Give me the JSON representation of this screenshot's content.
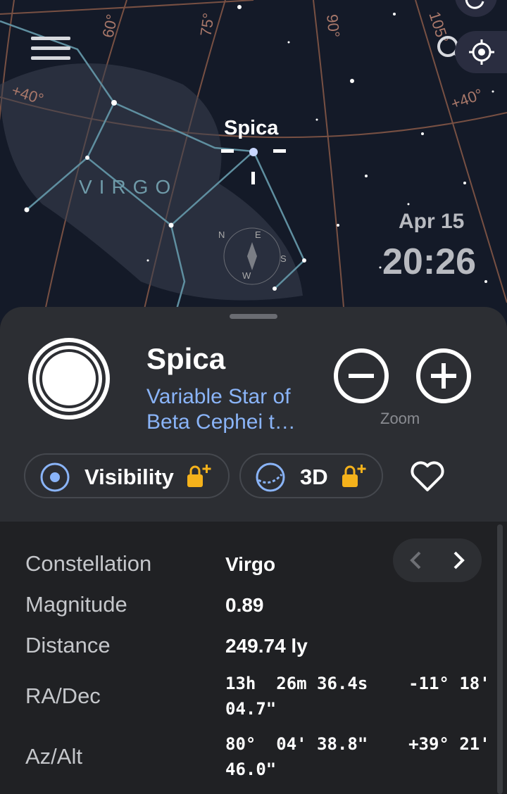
{
  "sky": {
    "constellation_label": "VIRGO",
    "target_label": "Spica",
    "date": "Apr 15",
    "time": "20:26",
    "grid_labels": [
      "60°",
      "75°",
      "90°",
      "105°",
      "+40°",
      "+40°"
    ],
    "compass": [
      "N",
      "E",
      "S",
      "W"
    ]
  },
  "object": {
    "name": "Spica",
    "type": "Variable Star of Beta Cephei t…",
    "zoom_label": "Zoom",
    "visibility_label": "Visibility",
    "threed_label": "3D"
  },
  "details": {
    "rows": [
      {
        "label": "Constellation",
        "value": "Virgo"
      },
      {
        "label": "Magnitude",
        "value": "0.89"
      },
      {
        "label": "Distance",
        "value": "249.74 ly"
      }
    ],
    "radec_label": "RA/Dec",
    "radec_line1": "13h  26m 36.4s    -11° 18'",
    "radec_line2": "04.7\"",
    "azalt_label": "Az/Alt",
    "azalt_line1": "80°  04' 38.8\"    +39° 21'",
    "azalt_line2": "46.0\""
  },
  "colors": {
    "accent": "#8ab4f8",
    "lock": "#f5b21b",
    "grid": "#a9786a",
    "constellation_line": "#5f8fa0"
  }
}
